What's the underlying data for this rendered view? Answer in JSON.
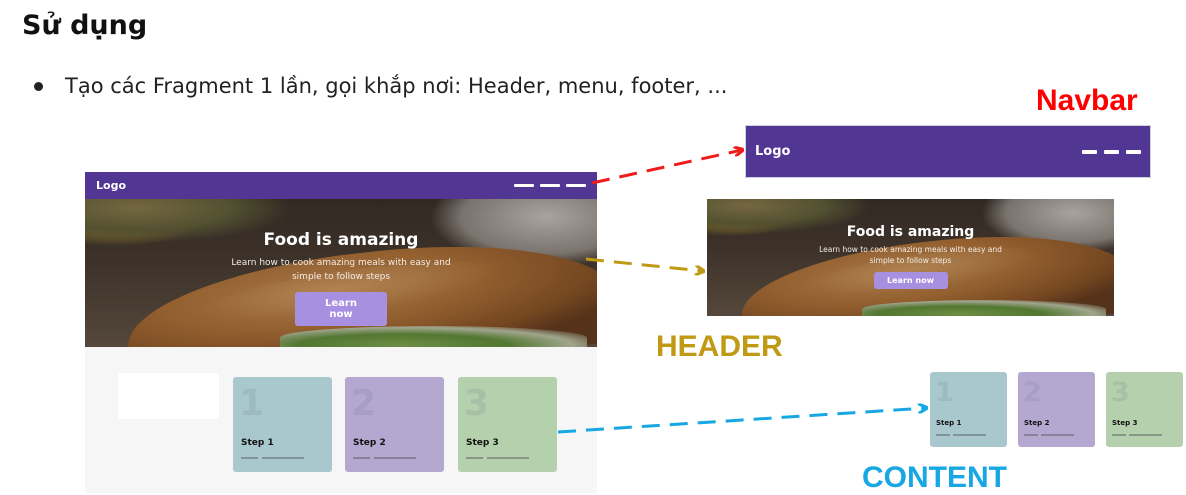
{
  "slide": {
    "title": "Sử dụng",
    "bullet": "Tạo các Fragment 1 lần, gọi khắp nơi: Header, menu, footer, ..."
  },
  "labels": {
    "navbar": "Navbar",
    "header": "HEADER",
    "content": "CONTENT"
  },
  "mockup": {
    "navbar": {
      "logo": "Logo"
    },
    "hero": {
      "title": "Food is amazing",
      "subtitle": "Learn how to cook amazing meals with easy and simple to follow steps",
      "button": "Learn now"
    },
    "steps": [
      {
        "number": "1",
        "label": "Step 1"
      },
      {
        "number": "2",
        "label": "Step 2"
      },
      {
        "number": "3",
        "label": "Step 3"
      }
    ]
  },
  "colors": {
    "navbar_bg": "#523694",
    "button_bg": "#a890e0",
    "navbar_label": "#ff0000",
    "header_label": "#c19a14",
    "content_label": "#17a8e3",
    "card_blue": "#a8c8ce",
    "card_purple": "#b4a8d0",
    "card_green": "#b4d0ac"
  },
  "icons": {
    "menu": "hamburger-menu-icon",
    "bullet": "bullet-dot"
  }
}
